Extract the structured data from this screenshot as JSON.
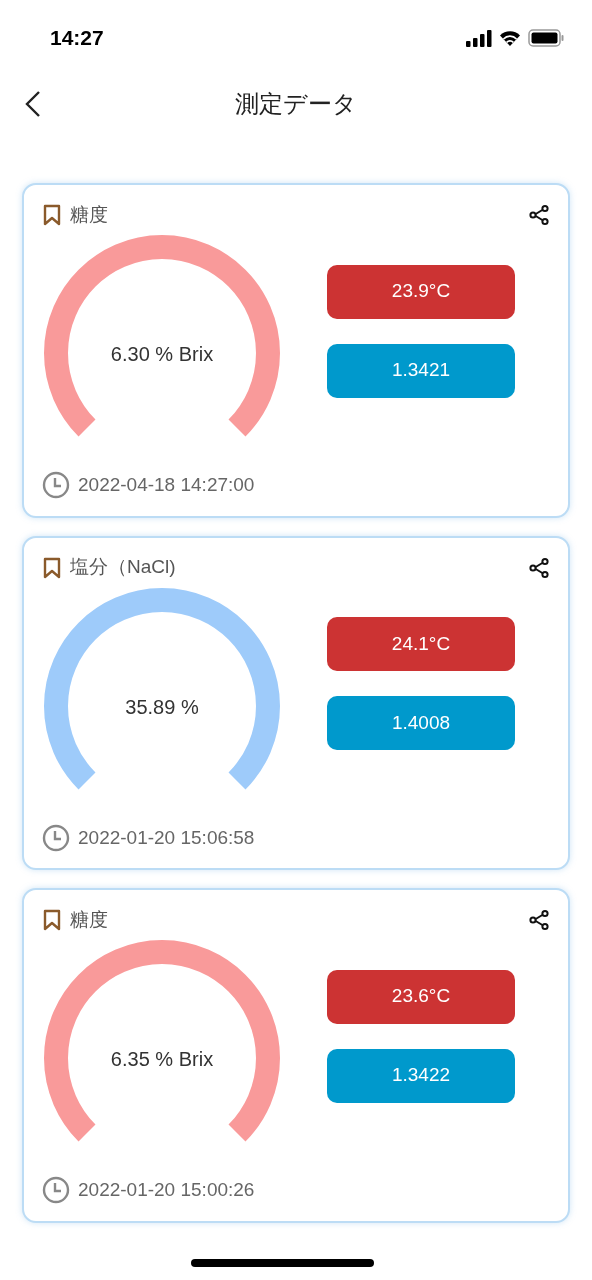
{
  "status_bar": {
    "time": "14:27"
  },
  "header": {
    "title": "測定データ"
  },
  "records": [
    {
      "label": "糖度",
      "color": "#f99a9a",
      "reading": "6.30 % Brix",
      "temperature": "23.9°C",
      "refractive_index": "1.3421",
      "timestamp": "2022-04-18 14:27:00"
    },
    {
      "label": "塩分（NaCl)",
      "color": "#9ecbfa",
      "reading": "35.89 %",
      "temperature": "24.1°C",
      "refractive_index": "1.4008",
      "timestamp": "2022-01-20 15:06:58"
    },
    {
      "label": "糖度",
      "color": "#f99a9a",
      "reading": "6.35 % Brix",
      "temperature": "23.6°C",
      "refractive_index": "1.3422",
      "timestamp": "2022-01-20 15:00:26"
    }
  ]
}
